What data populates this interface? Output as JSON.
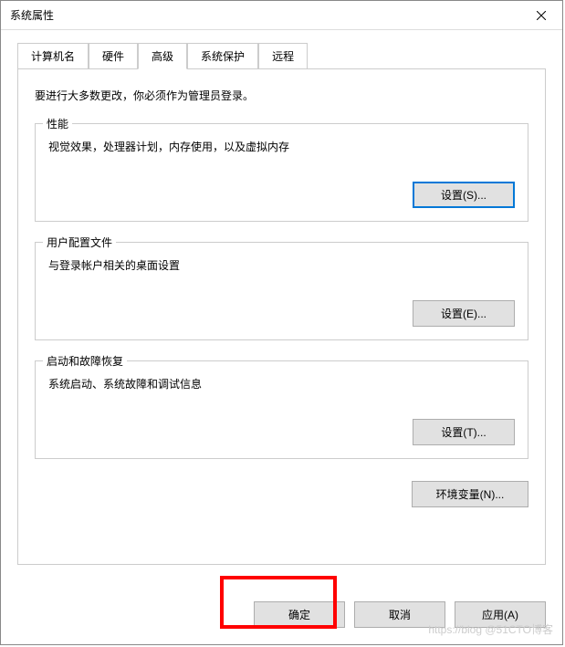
{
  "titlebar": {
    "title": "系统属性"
  },
  "tabs": {
    "computer_name": "计算机名",
    "hardware": "硬件",
    "advanced": "高级",
    "system_protection": "系统保护",
    "remote": "远程"
  },
  "intro": "要进行大多数更改，你必须作为管理员登录。",
  "group_performance": {
    "legend": "性能",
    "desc": "视觉效果，处理器计划，内存使用，以及虚拟内存",
    "button": "设置(S)..."
  },
  "group_userprofile": {
    "legend": "用户配置文件",
    "desc": "与登录帐户相关的桌面设置",
    "button": "设置(E)..."
  },
  "group_startup": {
    "legend": "启动和故障恢复",
    "desc": "系统启动、系统故障和调试信息",
    "button": "设置(T)..."
  },
  "env_button": "环境变量(N)...",
  "buttons": {
    "ok": "确定",
    "cancel": "取消",
    "apply": "应用(A)"
  },
  "watermark": "https://blog @51CTO博客"
}
